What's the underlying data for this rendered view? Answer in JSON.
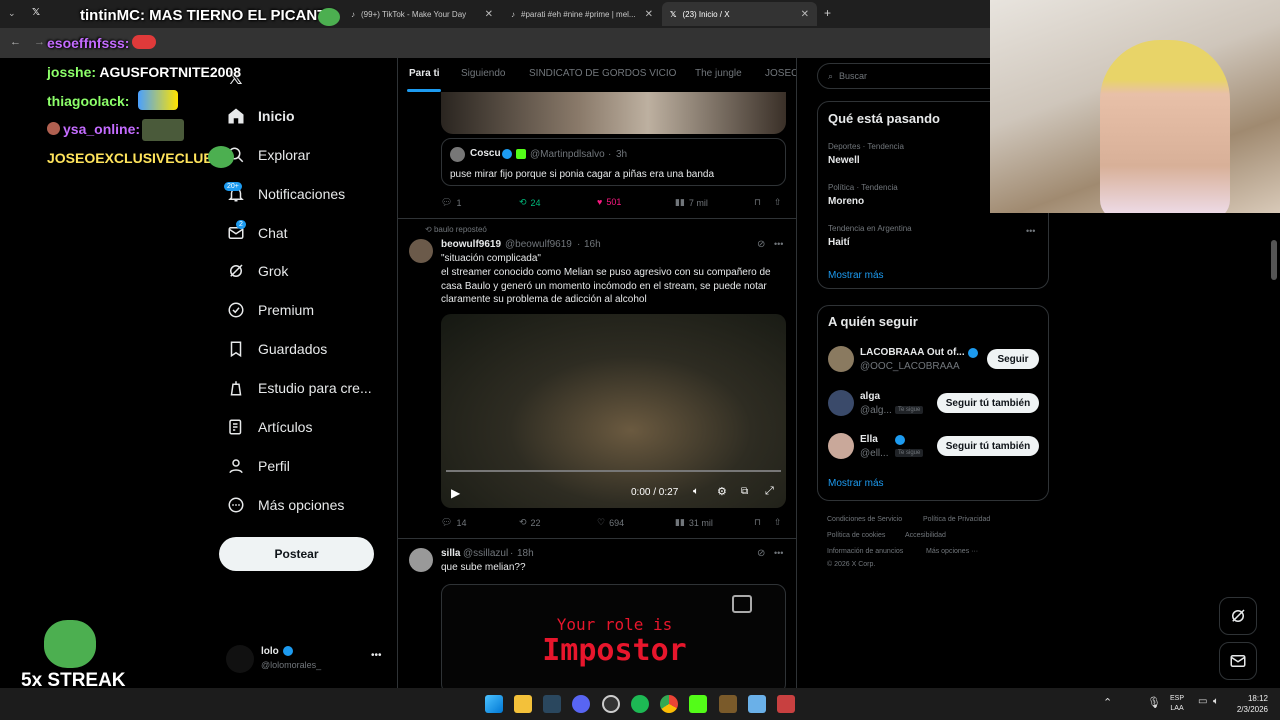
{
  "browser": {
    "tabs": [
      {
        "label": "(99+) TikTok - Make Your Day",
        "active": false
      },
      {
        "label": "#parati #eh #nine #prime | mel...",
        "active": false
      },
      {
        "label": "(23) Inicio / X",
        "active": true
      }
    ],
    "new_tab": "+"
  },
  "stream_overlay": {
    "title_text": "tintinMC: MAS TIERNO EL PICANTE",
    "chat": [
      {
        "user": "esoeffnfsss:",
        "color": "#c46cff"
      },
      {
        "user": "josshe:",
        "message": "AGUSFORTNITE2008",
        "color": "#8dff6a"
      },
      {
        "user": "thiagoolack:",
        "color": "#8dff6a"
      },
      {
        "user": "ysa_online:",
        "color": "#c46cff"
      },
      {
        "user": "JOSEOEXCLUSIVECLUB:",
        "color": "#ffe45c"
      }
    ],
    "streak": "5x STREAK"
  },
  "nav": {
    "items": [
      {
        "label": "Inicio",
        "icon": "home-icon",
        "bold": true
      },
      {
        "label": "Explorar",
        "icon": "search-icon"
      },
      {
        "label": "Notificaciones",
        "icon": "bell-icon",
        "badge": "20+"
      },
      {
        "label": "Chat",
        "icon": "mail-icon",
        "badge": "2"
      },
      {
        "label": "Grok",
        "icon": "grok-icon"
      },
      {
        "label": "Premium",
        "icon": "premium-icon"
      },
      {
        "label": "Guardados",
        "icon": "bookmark-icon"
      },
      {
        "label": "Estudio para cre...",
        "icon": "studio-icon"
      },
      {
        "label": "Artículos",
        "icon": "articles-icon"
      },
      {
        "label": "Perfil",
        "icon": "person-icon"
      },
      {
        "label": "Más opciones",
        "icon": "more-circle-icon"
      }
    ],
    "post_button": "Postear",
    "account": {
      "name": "lolo",
      "handle": "@lolomorales_"
    }
  },
  "timeline": {
    "tabs": [
      "Para ti",
      "Siguiendo",
      "SINDICATO DE GORDOS VICIO",
      "The jungle",
      "JOSEO"
    ],
    "quoted": {
      "name": "Coscu",
      "handle": "@Martinpdlsalvo",
      "time": "3h",
      "text": "puse mirar fijo porque si ponia cagar a piñas era una banda"
    },
    "post1_stats": {
      "replies": "1",
      "reposts": "24",
      "likes": "501",
      "views": "7 mil"
    },
    "post2": {
      "repost_by": "baulo reposteó",
      "name": "beowulf9619",
      "handle": "@beowulf9619",
      "time": "16h",
      "line1": "\"situación complicada\"",
      "line2": "el streamer conocido como Melian se puso agresivo con su compañero de casa Baulo y generó un momento incómodo en el stream, se puede notar claramente su problema de adicción al alcohol",
      "video_time": "0:00 / 0:27",
      "stats": {
        "replies": "14",
        "reposts": "22",
        "likes": "694",
        "views": "31 mil"
      }
    },
    "post3": {
      "name": "silla",
      "handle": "@ssillazul",
      "time": "18h",
      "text": "que sube melian??",
      "image_line1": "Your role is",
      "image_line2": "Impostor"
    }
  },
  "right": {
    "search_placeholder": "Buscar",
    "trends_title": "Qué está pasando",
    "trends": [
      {
        "category": "Deportes · Tendencia",
        "name": "Newell"
      },
      {
        "category": "Política · Tendencia",
        "name": "Moreno"
      },
      {
        "category": "Tendencia en Argentina",
        "name": "Haití"
      }
    ],
    "show_more": "Mostrar más",
    "follow_title": "A quién seguir",
    "follow": [
      {
        "name": "LACOBRAAA Out of...",
        "handle": "@OOC_LACOBRAAA",
        "button": "Seguir",
        "follows_you": ""
      },
      {
        "name": "alga",
        "handle": "@alg...",
        "button": "Seguir tú también",
        "follows_you": "Te sigue"
      },
      {
        "name": "Ella",
        "handle": "@ell...",
        "button": "Seguir tú también",
        "follows_you": "Te sigue"
      }
    ],
    "follow_show_more": "Mostrar más",
    "footer": {
      "l1a": "Condiciones de Servicio",
      "l1b": "Política de Privacidad",
      "l2a": "Política de cookies",
      "l2b": "Accesibilidad",
      "l3a": "Información de anuncios",
      "l3b": "Más opciones ···",
      "copy": "© 2026 X Corp."
    }
  },
  "taskbar": {
    "lang": "ESP",
    "lang2": "LAA",
    "time": "18:12",
    "date": "2/3/2026"
  },
  "colors": {
    "accent": "#1d9bf0",
    "like": "#f91880",
    "repost": "#00ba7c"
  }
}
